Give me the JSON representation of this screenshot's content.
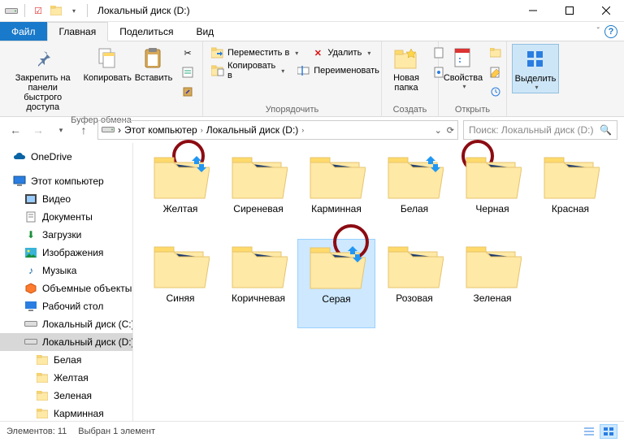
{
  "titlebar": {
    "title": "Локальный диск (D:)"
  },
  "tabs": {
    "file": "Файл",
    "home": "Главная",
    "share": "Поделиться",
    "view": "Вид"
  },
  "ribbon": {
    "clipboard": {
      "pin": "Закрепить на панели\nбыстрого доступа",
      "copy": "Копировать",
      "paste": "Вставить",
      "group": "Буфер обмена"
    },
    "organize": {
      "move": "Переместить в",
      "copyto": "Копировать в",
      "delete": "Удалить",
      "rename": "Переименовать",
      "group": "Упорядочить"
    },
    "create": {
      "newfolder": "Новая\nпапка",
      "group": "Создать"
    },
    "open": {
      "properties": "Свойства",
      "group": "Открыть"
    },
    "select": {
      "select": "Выделить",
      "group": ""
    }
  },
  "breadcrumb": {
    "thispc": "Этот компьютер",
    "drive": "Локальный диск (D:)"
  },
  "search": {
    "placeholder": "Поиск: Локальный диск (D:)"
  },
  "tree": {
    "onedrive": "OneDrive",
    "thispc": "Этот компьютер",
    "videos": "Видео",
    "documents": "Документы",
    "downloads": "Загрузки",
    "pictures": "Изображения",
    "music": "Музыка",
    "objects3d": "Объемные объекты",
    "desktop": "Рабочий стол",
    "cdrive": "Локальный диск (C:)",
    "ddrive": "Локальный диск (D:)",
    "f_white": "Белая",
    "f_yellow": "Желтая",
    "f_green": "Зеленая",
    "f_carmine": "Карминная"
  },
  "folders": {
    "row1": [
      "Желтая",
      "Сиреневая",
      "Карминная",
      "Белая",
      "Черная",
      "Красная"
    ],
    "row2": [
      "Синяя",
      "Коричневая",
      "Серая",
      "Розовая",
      "Зеленая"
    ]
  },
  "status": {
    "elements_label": "Элементов:",
    "elements_count": "11",
    "selected": "Выбран 1 элемент"
  }
}
